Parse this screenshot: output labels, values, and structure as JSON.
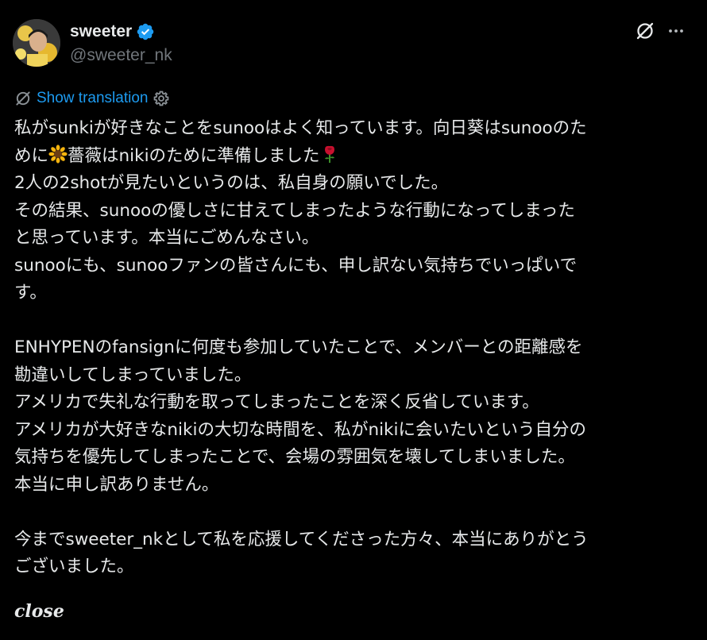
{
  "author": {
    "display_name": "sweeter",
    "handle": "@sweeter_nk",
    "verified": true,
    "avatar_icon": "profile-photo-avatar"
  },
  "actions": {
    "grok_icon": "grok-slash-icon",
    "more_icon": "more-dots-icon"
  },
  "translation": {
    "label": "Show translation",
    "icon_left": "grok-slash-icon",
    "icon_right": "gear-icon"
  },
  "post": {
    "l1a": "私がsunkiが好きなことをsunooはよく知っています。向日葵はsunooのた",
    "l2a": "めに",
    "l2b": "薔薇はnikiのために準備しました",
    "l3": "2人の2shotが見たいというのは、私自身の願いでした。",
    "l4": "その結果、sunooの優しさに甘えてしまったような行動になってしまった",
    "l5": "と思っています。本当にごめんなさい。",
    "l6": "sunooにも、sunooファンの皆さんにも、申し訳ない気持ちでいっぱいで",
    "l7": "す。",
    "l9": "ENHYPENのfansignに何度も参加していたことで、メンバーとの距離感を",
    "l10": "勘違いしてしまっていました。",
    "l11": "アメリカで失礼な行動を取ってしまったことを深く反省しています。",
    "l12": "アメリカが大好きなnikiの大切な時間を、私がnikiに会いたいという自分の",
    "l13": "気持ちを優先してしまったことで、会場の雰囲気を壊してしまいました。",
    "l14": "本当に申し訳ありません。",
    "l16": "今までsweeter_nkとして私を応援してくださった方々、本当にありがとう",
    "l17": "ございました。",
    "closing": "close",
    "emoji_1": "sunflower-emoji",
    "emoji_2": "rose-emoji"
  },
  "colors": {
    "background": "#000000",
    "text": "#e7e9ea",
    "secondary_text": "#71767b",
    "link": "#1d9bf0",
    "verified": "#1d9bf0"
  }
}
